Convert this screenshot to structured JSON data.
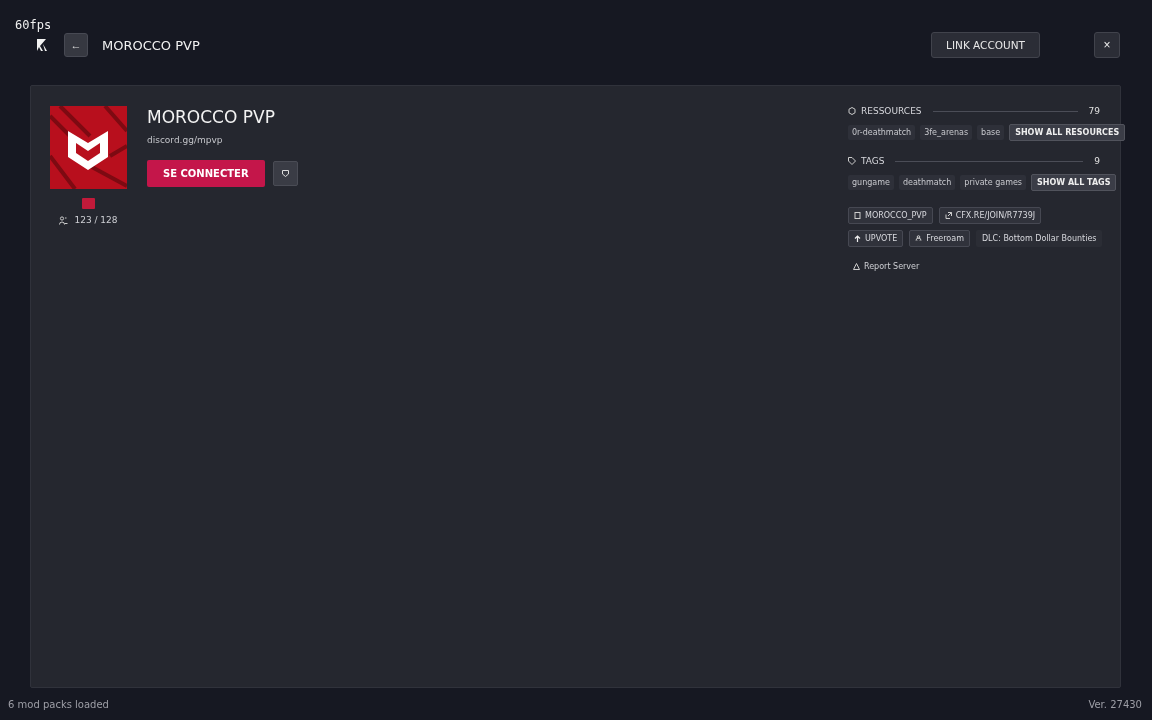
{
  "fps": "60fps",
  "header": {
    "back": "←",
    "title": "MOROCCO PVP",
    "link_account": "LINK ACCOUNT",
    "close": "×"
  },
  "server": {
    "name": "MOROCCO PVP",
    "url": "discord.gg/mpvp",
    "connect": "SE CONNECTER",
    "players": "123 / 128"
  },
  "resources": {
    "label": "RESSOURCES",
    "count": "79",
    "items": [
      "0r-deathmatch",
      "3fe_arenas",
      "base"
    ],
    "show_all": "SHOW ALL RESOURCES"
  },
  "tags": {
    "label": "TAGS",
    "count": "9",
    "items": [
      "gungame",
      "deathmatch",
      "private games"
    ],
    "show_all": "SHOW ALL TAGS"
  },
  "links": [
    {
      "kind": "project",
      "label": "MOROCCO_PVP"
    },
    {
      "kind": "join",
      "label": "CFX.RE/JOIN/R7739J"
    }
  ],
  "actions": [
    {
      "kind": "upvote",
      "label": "UPVOTE"
    },
    {
      "kind": "gametype",
      "label": "Freeroam"
    },
    {
      "kind": "plain",
      "label": "DLC: Bottom Dollar Bounties"
    }
  ],
  "report": "Report Server",
  "status": {
    "left": "6 mod packs loaded",
    "right": "Ver. 27430"
  }
}
